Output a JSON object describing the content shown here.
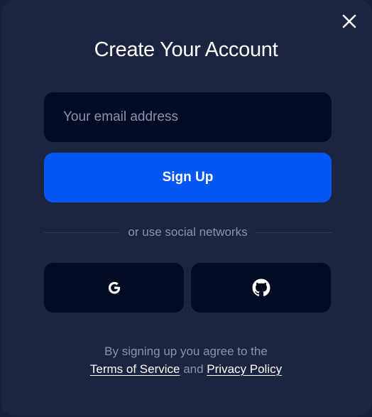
{
  "modal": {
    "title": "Create Your Account",
    "email_placeholder": "Your email address",
    "email_value": "",
    "signup_label": "Sign Up",
    "divider_text": "or use social networks",
    "social": {
      "google_icon": "google-icon",
      "github_icon": "github-icon"
    },
    "legal": {
      "prefix": "By signing up you agree to the",
      "terms_label": "Terms of Service",
      "conjunction": "and",
      "privacy_label": "Privacy Policy"
    },
    "close_icon": "close-icon"
  },
  "colors": {
    "background": "#1c2540",
    "field_background": "#030b22",
    "accent": "#0656f3",
    "muted_text": "#8a93ad"
  }
}
